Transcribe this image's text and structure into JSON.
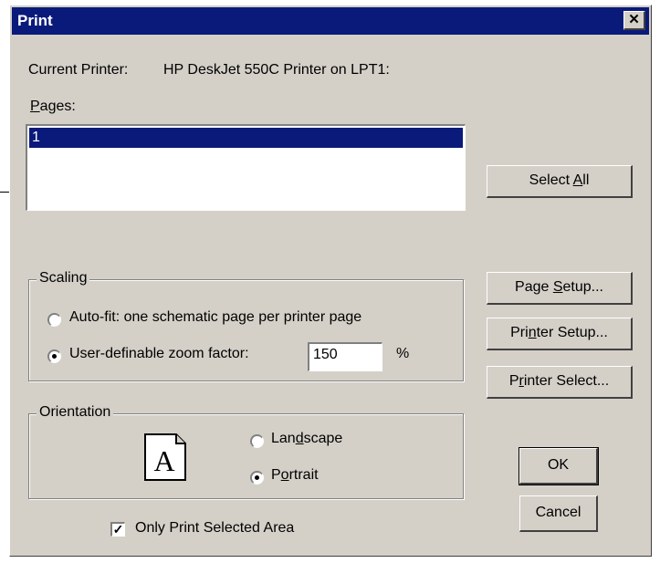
{
  "window": {
    "title": "Print",
    "close_glyph": "✕"
  },
  "printer": {
    "label": "Current Printer:",
    "value": "HP DeskJet 550C Printer on LPT1:"
  },
  "pages": {
    "label_u": "P",
    "label_rest": "ages:",
    "items": [
      "1"
    ]
  },
  "buttons": {
    "select_all": {
      "pre": "Select ",
      "u": "A",
      "post": "ll"
    },
    "page_setup": {
      "pre": "Page ",
      "u": "S",
      "post": "etup..."
    },
    "printer_setup": {
      "pre": "Pri",
      "u": "n",
      "post": "ter Setup..."
    },
    "printer_select": {
      "pre": "P",
      "u": "r",
      "post": "inter Select..."
    },
    "ok": "OK",
    "cancel": "Cancel"
  },
  "scaling": {
    "title": "Scaling",
    "autofit_label": "Auto-fit:  one schematic page per printer page",
    "autofit_selected": false,
    "user_zoom_label": "User-definable zoom factor:",
    "user_zoom_selected": true,
    "zoom_value": "150",
    "zoom_unit": "%"
  },
  "orientation": {
    "title": "Orientation",
    "icon_letter": "A",
    "landscape": {
      "pre": "Lan",
      "u": "d",
      "post": "scape",
      "selected": false
    },
    "portrait": {
      "pre": "P",
      "u": "o",
      "post": "rtrait",
      "selected": true
    }
  },
  "only_selected": {
    "label": "Only Print Selected Area",
    "checked": true,
    "check_glyph": "✓"
  }
}
